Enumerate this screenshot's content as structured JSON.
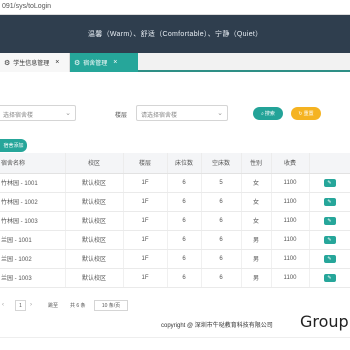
{
  "browser": {
    "url": "091/sys/toLogin"
  },
  "header": {
    "slogan": "温馨（Warm）、舒适（Comfortable）、宁静（Quiet）"
  },
  "tabs": [
    {
      "label": "学生信息管理",
      "close": "×",
      "active": false,
      "icon": "gear-icon"
    },
    {
      "label": "宿舍管理",
      "close": "×",
      "active": true,
      "icon": "gear-icon"
    }
  ],
  "filters": {
    "campus_placeholder": "选择宿舍楼",
    "building_label": "楼层",
    "building_placeholder": "请选择宿舍楼"
  },
  "buttons": {
    "search": "搜索",
    "reset": "重置",
    "add": "宿舍添加"
  },
  "table": {
    "headers": [
      "宿舍名称",
      "校区",
      "楼层",
      "床位数",
      "空床数",
      "性别",
      "收费",
      ""
    ],
    "rows": [
      [
        "竹林园 - 1001",
        "默认校区",
        "1F",
        "6",
        "5",
        "女",
        "1100"
      ],
      [
        "竹林园 - 1002",
        "默认校区",
        "1F",
        "6",
        "6",
        "女",
        "1100"
      ],
      [
        "竹林园 - 1003",
        "默认校区",
        "1F",
        "6",
        "6",
        "女",
        "1100"
      ],
      [
        "兰园 - 1001",
        "默认校区",
        "1F",
        "6",
        "6",
        "男",
        "1100"
      ],
      [
        "兰园 - 1002",
        "默认校区",
        "1F",
        "6",
        "6",
        "男",
        "1100"
      ],
      [
        "兰园 - 1003",
        "默认校区",
        "1F",
        "6",
        "6",
        "男",
        "1100"
      ]
    ],
    "action_label": "编辑"
  },
  "pager": {
    "current_page": "1",
    "goto_label": "跳至",
    "confirm": "确定",
    "total": "共 6 条",
    "page_size": "10 条/页"
  },
  "footer": {
    "copyright": "copyright @ 深圳市牛哒教育科技有限公司",
    "brand": "Group"
  }
}
